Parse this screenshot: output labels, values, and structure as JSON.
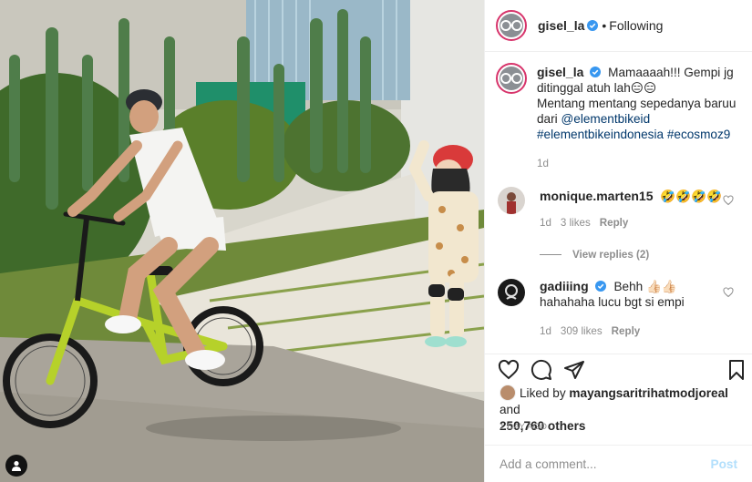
{
  "post": {
    "username": "gisel_la",
    "follow_label": "Following",
    "follow_sep": "•"
  },
  "caption": {
    "username": "gisel_la",
    "line1": "Mamaaaah!!! Gempi jg ditinggal atuh lah😑😑",
    "line2_prefix": "Mentang mentang sepedanya baruu dari ",
    "mention": "@elementbikeid",
    "tags": "#elementbikeindonesia #ecosmoz9",
    "age": "1d"
  },
  "comments": [
    {
      "username": "monique.marten15",
      "text": "🤣🤣🤣🤣",
      "age": "1d",
      "likes": "3 likes",
      "reply_label": "Reply",
      "verified": false
    },
    {
      "username": "gadiiing",
      "text": "Behh 👍🏻👍🏻",
      "text2": "hahahaha lucu bgt si empi",
      "age": "1d",
      "likes": "309 likes",
      "reply_label": "Reply",
      "verified": true
    }
  ],
  "view_replies": "View replies (2)",
  "likes": {
    "prefix": "Liked by ",
    "user": "mayangsaritrihatmodjoreal",
    "and": " and",
    "count": "250,760 others"
  },
  "timestamp": "1 DAY AGO",
  "comment_box": {
    "placeholder": "Add a comment...",
    "post_label": "Post"
  },
  "icons": {
    "verified": "verified-badge-icon",
    "like": "heart-icon",
    "comment": "comment-bubble-icon",
    "share": "paper-plane-icon",
    "save": "bookmark-icon",
    "tagged": "user-tag-icon"
  },
  "colors": {
    "verified_blue": "#3897f0",
    "link": "#00376b",
    "muted": "#8e8e8e",
    "post_button": "#b2dffc",
    "avatar_ring": "#d7346b"
  }
}
